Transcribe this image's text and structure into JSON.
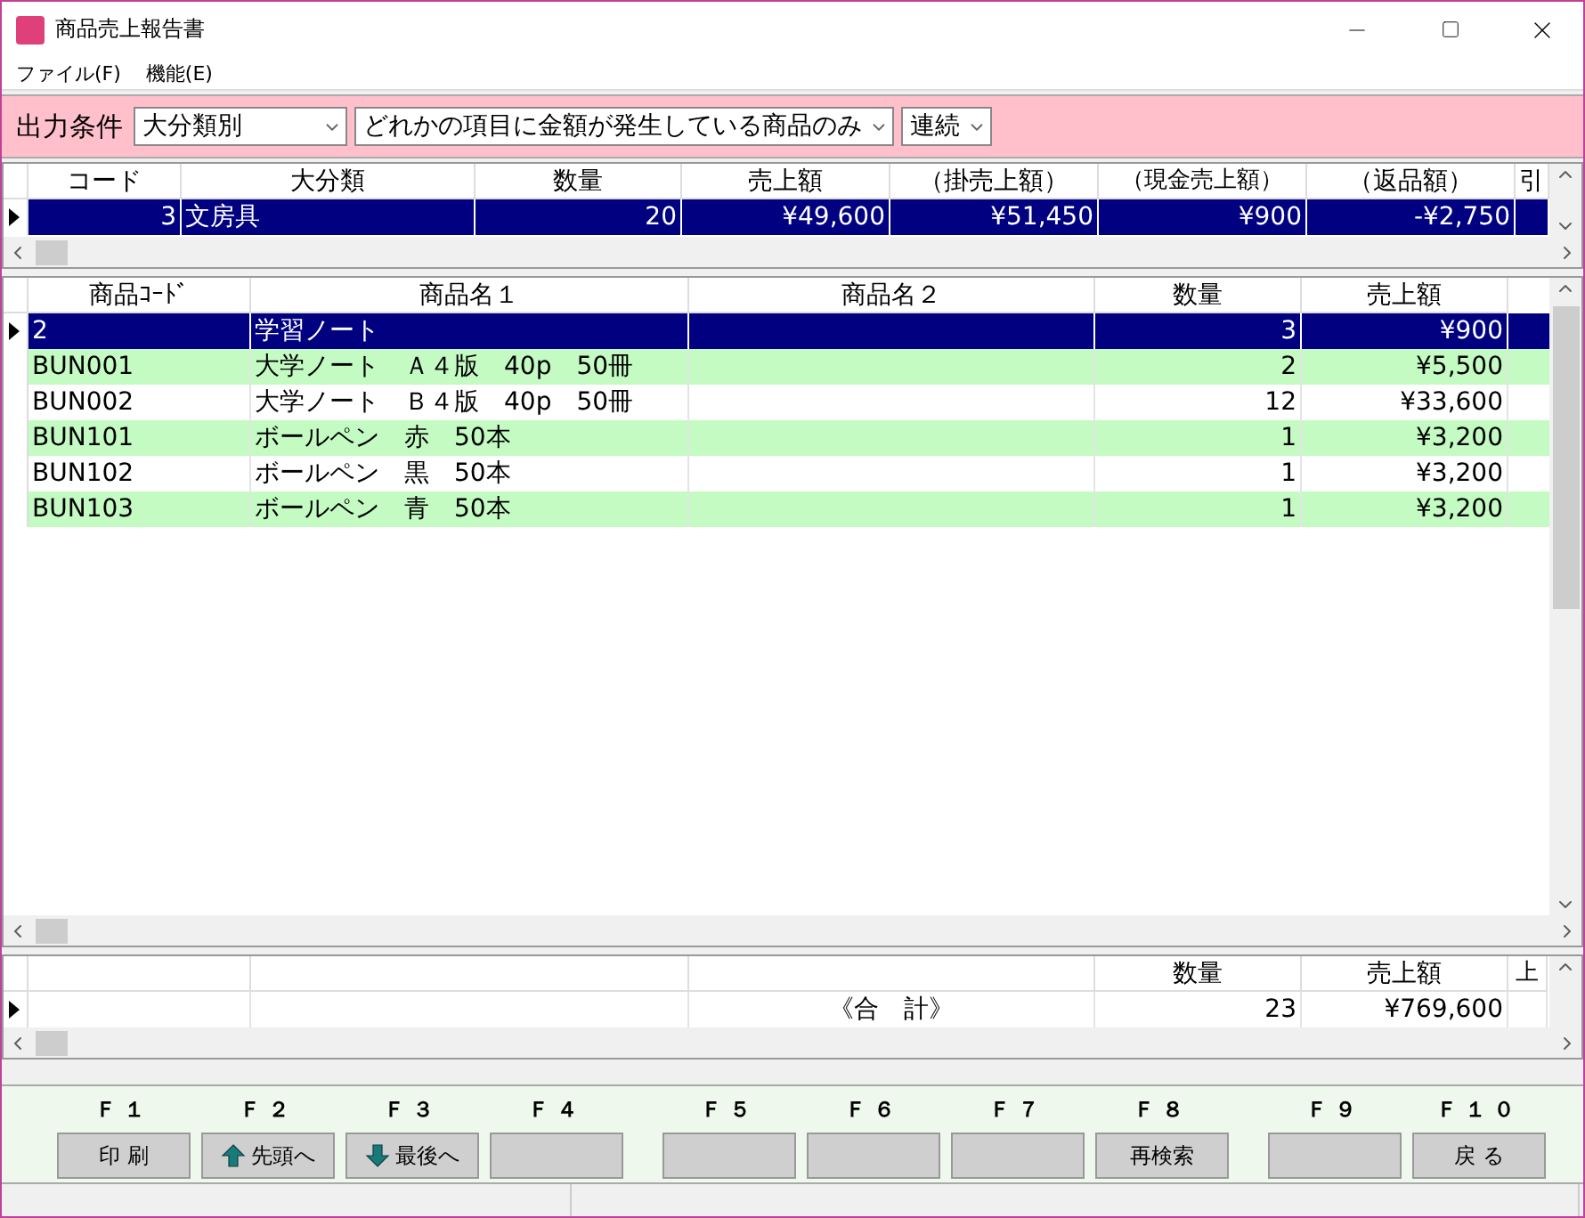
{
  "window": {
    "title": "商品売上報告書",
    "menu": [
      "ファイル(F)",
      "機能(E)"
    ]
  },
  "conditions": {
    "label": "出力条件",
    "selects": [
      {
        "value": "大分類別"
      },
      {
        "value": "どれかの項目に金額が発生している商品のみ"
      },
      {
        "value": "連続"
      }
    ]
  },
  "summary_grid": {
    "columns": [
      "コード",
      "大分類",
      "数量",
      "売上額",
      "（掛売上額）",
      "（現金売上額）",
      "（返品額）",
      "引"
    ],
    "rows": [
      {
        "selected": true,
        "current": true,
        "cells": [
          "3",
          "文房具",
          "20",
          "¥49,600",
          "¥51,450",
          "¥900",
          "-¥2,750",
          ""
        ]
      }
    ]
  },
  "detail_grid": {
    "columns": [
      "商品ｺｰﾄﾞ",
      "商品名１",
      "商品名２",
      "数量",
      "売上額"
    ],
    "rows": [
      {
        "selected": true,
        "current": true,
        "cells": [
          "2",
          "学習ノート",
          "",
          "3",
          "¥900"
        ]
      },
      {
        "selected": false,
        "current": false,
        "cells": [
          "BUN001",
          "大学ノート　Ａ４版　40p　50冊",
          "",
          "2",
          "¥5,500"
        ]
      },
      {
        "selected": false,
        "current": false,
        "cells": [
          "BUN002",
          "大学ノート　Ｂ４版　40p　50冊",
          "",
          "12",
          "¥33,600"
        ]
      },
      {
        "selected": false,
        "current": false,
        "cells": [
          "BUN101",
          "ボールペン　赤　50本",
          "",
          "1",
          "¥3,200"
        ]
      },
      {
        "selected": false,
        "current": false,
        "cells": [
          "BUN102",
          "ボールペン　黒　50本",
          "",
          "1",
          "¥3,200"
        ]
      },
      {
        "selected": false,
        "current": false,
        "cells": [
          "BUN103",
          "ボールペン　青　50本",
          "",
          "1",
          "¥3,200"
        ]
      }
    ]
  },
  "totals_grid": {
    "columns": [
      "",
      "",
      "",
      "数量",
      "売上額",
      "上"
    ],
    "rows": [
      {
        "selected": false,
        "current": true,
        "cells": [
          "",
          "",
          "《合　計》",
          "23",
          "¥769,600",
          ""
        ]
      }
    ]
  },
  "function_keys": [
    {
      "key": "Ｆ１",
      "label": "印 刷",
      "kind": "plain"
    },
    {
      "key": "Ｆ２",
      "label": "先頭へ",
      "kind": "up"
    },
    {
      "key": "Ｆ３",
      "label": "最後へ",
      "kind": "down"
    },
    {
      "key": "Ｆ４",
      "kind": "plain"
    },
    {
      "key": "Ｆ５",
      "kind": "plain"
    },
    {
      "key": "Ｆ６",
      "kind": "plain"
    },
    {
      "key": "Ｆ７",
      "kind": "plain"
    },
    {
      "key": "Ｆ８",
      "label": "再検索",
      "kind": "plain"
    },
    {
      "key": "Ｆ９",
      "kind": "plain"
    },
    {
      "key": "Ｆ１０",
      "label": "戻 る",
      "kind": "plain"
    }
  ]
}
